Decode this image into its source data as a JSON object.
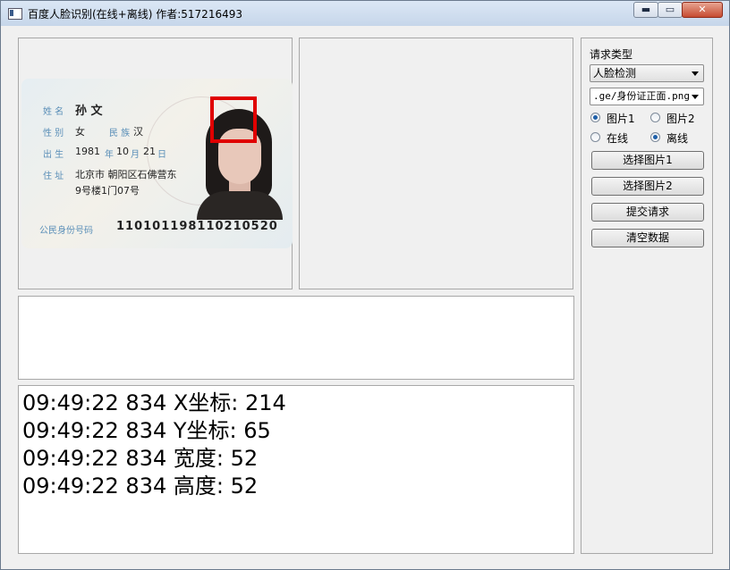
{
  "window": {
    "title": "百度人脸识别(在线+离线) 作者:517216493",
    "min_glyph": "▬",
    "max_glyph": "▭",
    "close_glyph": "✕"
  },
  "idcard": {
    "name_label": "姓 名",
    "name_value": "孙 文",
    "gender_label": "性 别",
    "gender_value": "女",
    "ethnicity_label": "民 族",
    "ethnicity_value": "汉",
    "birth_label": "出 生",
    "birth_year": "1981",
    "year_label": "年",
    "birth_month": "10",
    "month_label": "月",
    "birth_day": "21",
    "day_label": "日",
    "address_label": "住 址",
    "address_line1": "北京市 朝阳区石佛营东",
    "address_line2": "9号楼1门07号",
    "id_label": "公民身份号码",
    "id_number": "110101198110210520"
  },
  "controls": {
    "request_type_label": "请求类型",
    "request_type_value": "人脸检测",
    "file_path": ".ge/身份证正面.png",
    "radio_image1": "图片1",
    "radio_image2": "图片2",
    "radio_online": "在线",
    "radio_offline": "离线",
    "image1_selected": true,
    "offline_selected": true,
    "btn_select1": "选择图片1",
    "btn_select2": "选择图片2",
    "btn_submit": "提交请求",
    "btn_clear": "清空数据"
  },
  "log": [
    "09:49:22 834  X坐标: 214",
    "09:49:22 834  Y坐标: 65",
    "09:49:22 834  宽度: 52",
    "09:49:22 834  高度: 52"
  ],
  "colors": {
    "face_box": "#e00000",
    "card_label": "#5b8fb8"
  }
}
